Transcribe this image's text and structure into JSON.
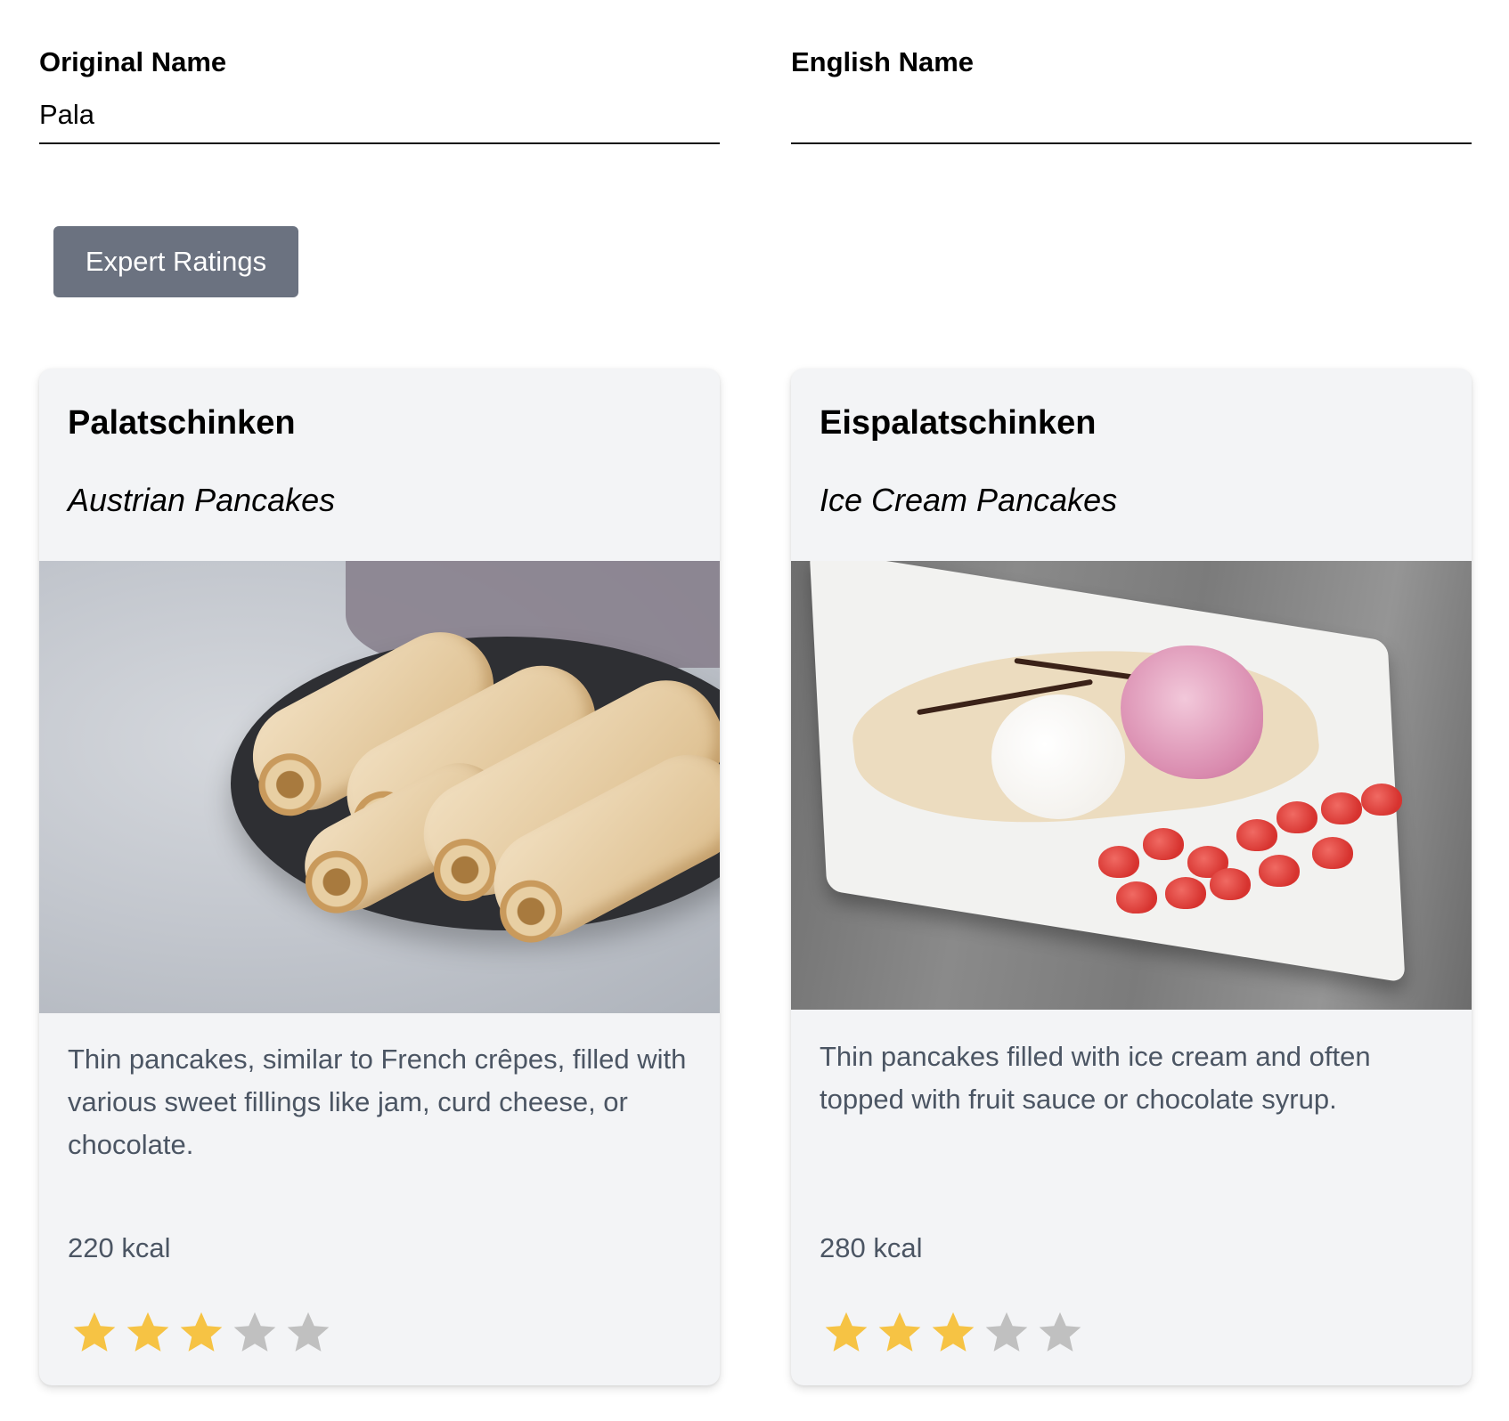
{
  "form": {
    "original_name": {
      "label": "Original Name",
      "value": "Pala",
      "placeholder": ""
    },
    "english_name": {
      "label": "English Name",
      "value": "",
      "placeholder": ""
    }
  },
  "actions": {
    "expert_ratings_label": "Expert Ratings"
  },
  "colors": {
    "button_bg": "#6b7280",
    "card_bg": "#f3f4f6",
    "body_text": "#4b5563",
    "star_filled": "#f6c344",
    "star_empty": "#c0c0c0"
  },
  "cards": [
    {
      "title": "Palatschinken",
      "subtitle": "Austrian Pancakes",
      "image_alt": "Rolled pancakes on a dark plate",
      "description": "Thin pancakes, similar to French crêpes, filled with various sweet fillings like jam, curd cheese, or chocolate.",
      "calories": "220 kcal",
      "rating": 3,
      "rating_max": 5
    },
    {
      "title": "Eispalatschinken",
      "subtitle": "Ice Cream Pancakes",
      "image_alt": "Pancakes with ice cream, whipped cream and strawberries on a white plate",
      "description": "Thin pancakes filled with ice cream and often topped with fruit sauce or chocolate syrup.",
      "calories": "280 kcal",
      "rating": 3,
      "rating_max": 5
    }
  ]
}
